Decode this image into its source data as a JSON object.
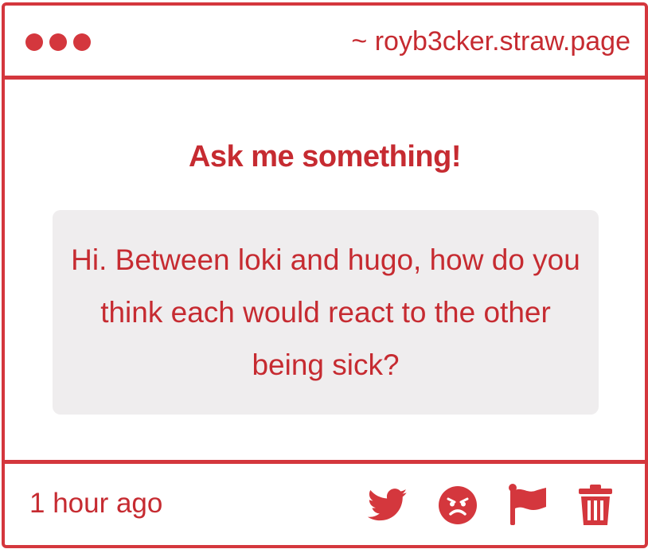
{
  "window": {
    "url": "~ royb3cker.straw.page"
  },
  "main": {
    "heading": "Ask me something!",
    "question": "Hi. Between loki and hugo, how do you think each would react to the other being sick?"
  },
  "footer": {
    "timestamp": "1 hour ago",
    "actions": [
      {
        "icon": "twitter-icon"
      },
      {
        "icon": "angry-face-icon"
      },
      {
        "icon": "flag-icon"
      },
      {
        "icon": "trash-icon"
      }
    ]
  },
  "colors": {
    "accent": "#d4373d",
    "text": "#c62b31",
    "question_background": "#efedee"
  }
}
